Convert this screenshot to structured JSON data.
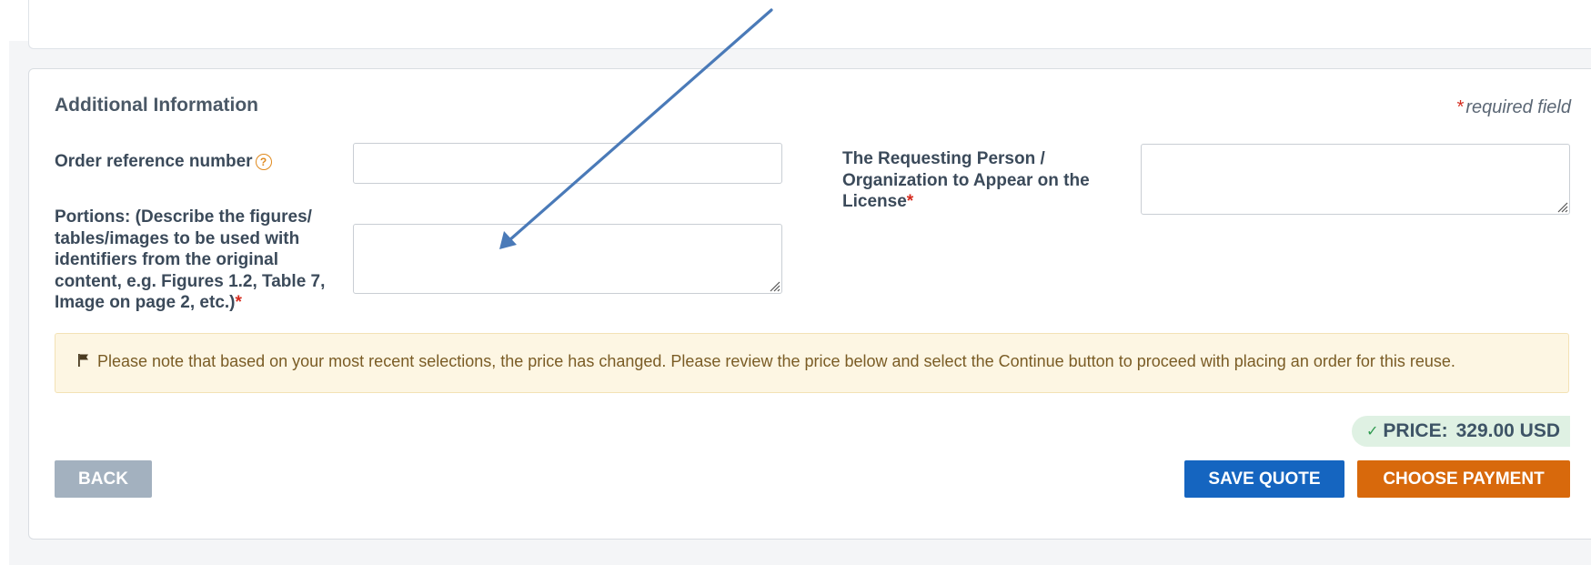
{
  "section": {
    "title": "Additional Information",
    "required_star": "*",
    "required_text": "required field"
  },
  "fields": {
    "order_reference": {
      "label": "Order reference number",
      "help_icon": "?",
      "value": "",
      "placeholder": ""
    },
    "portions": {
      "label_lines": [
        "Portions: (Describe the figures/",
        "tables/images to be used with",
        "identifiers from the original",
        "content, e.g. Figures 1.2, Table 7,",
        "Image on page 2, etc.)"
      ],
      "required_star": "*",
      "value": "",
      "placeholder": ""
    },
    "requesting_person": {
      "label_lines": [
        "The Requesting Person /",
        "Organization to Appear on the",
        "License"
      ],
      "required_star": "*",
      "value": "",
      "placeholder": ""
    }
  },
  "notice": {
    "icon": "flag-icon",
    "text": "Please note that based on your most recent selections, the price has changed. Please review the price below and select the Continue button to proceed with placing an order for this reuse."
  },
  "price": {
    "check_icon": "✓",
    "label": "PRICE:",
    "value": "329.00 USD"
  },
  "buttons": {
    "back": "BACK",
    "save_quote": "SAVE QUOTE",
    "choose_payment": "CHOOSE PAYMENT"
  },
  "colors": {
    "accent_blue": "#1565c0",
    "accent_orange": "#d8690c",
    "back_gray": "#a3b1bf",
    "required_red": "#d52b1e",
    "notice_bg": "#fdf6e3",
    "price_bg": "#dff1e3",
    "annotation_arrow": "#4a7ab8"
  }
}
